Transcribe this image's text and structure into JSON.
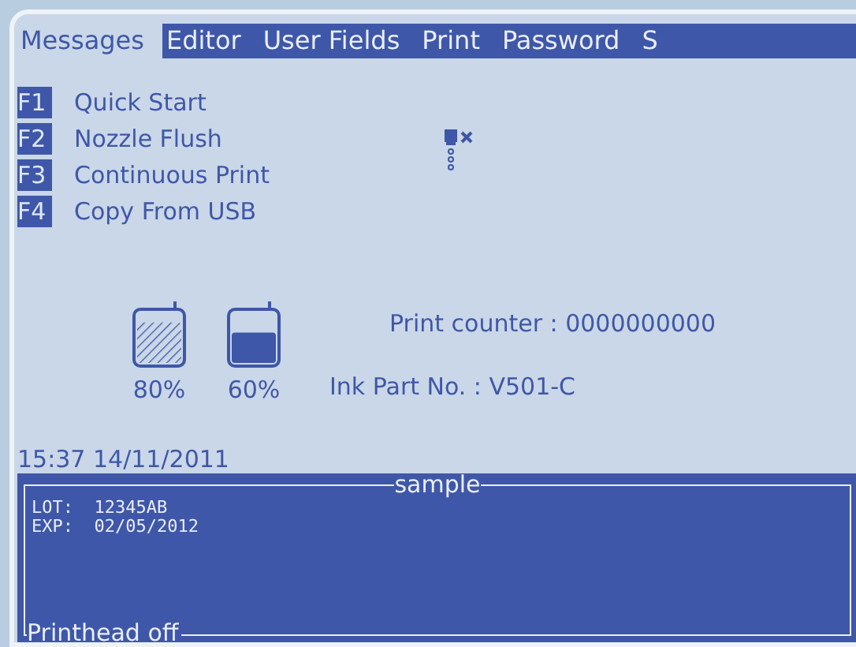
{
  "menu": [
    {
      "label": "Messages",
      "selected": true
    },
    {
      "label": "Editor",
      "selected": false
    },
    {
      "label": "User Fields",
      "selected": false
    },
    {
      "label": "Print",
      "selected": false
    },
    {
      "label": "Password",
      "selected": false
    },
    {
      "label": "S",
      "selected": false
    }
  ],
  "function_keys": [
    {
      "key": "F1",
      "label": "Quick Start"
    },
    {
      "key": "F2",
      "label": "Nozzle Flush"
    },
    {
      "key": "F3",
      "label": "Continuous Print"
    },
    {
      "key": "F4",
      "label": "Copy From USB"
    }
  ],
  "printhead_status": {
    "off": true
  },
  "tanks": [
    {
      "kind": "hatched",
      "level": 0.8,
      "reading": "80%"
    },
    {
      "kind": "solid",
      "level": 0.6,
      "reading": "60%"
    }
  ],
  "print_counter": "Print counter : 0000000000",
  "ink_part": "Ink Part No. : V501-C",
  "datetime": "15:37 14/11/2011",
  "message": {
    "name": "sample",
    "lines": [
      "LOT:  12345AB",
      "EXP:  02/05/2012"
    ],
    "status": "Printhead off"
  }
}
